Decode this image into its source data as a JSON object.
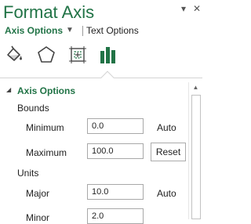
{
  "pane": {
    "title": "Format Axis",
    "dropdown_glyph": "▾",
    "close_glyph": "✕"
  },
  "tabs": {
    "axis_options": "Axis Options",
    "chevron_glyph": "▼",
    "text_options": "Text Options"
  },
  "icons": [
    "fill-line-icon",
    "effects-pentagon-icon",
    "size-properties-icon",
    "axis-options-bars-icon"
  ],
  "section": {
    "collapse_glyph": "◢",
    "title": "Axis Options",
    "bounds_label": "Bounds",
    "units_label": "Units",
    "fields": {
      "minimum": {
        "label": "Minimum",
        "value": "0.0",
        "state": "Auto"
      },
      "maximum": {
        "label": "Maximum",
        "value": "100.0",
        "button": "Reset"
      },
      "major": {
        "label": "Major",
        "value": "10.0",
        "state": "Auto"
      },
      "minor": {
        "label": "Minor",
        "value": "2.0"
      }
    }
  },
  "scrollbar": {
    "up_glyph": "▲"
  },
  "colors": {
    "accent": "#217346",
    "text": "#222222",
    "border": "#a8a8a8"
  }
}
